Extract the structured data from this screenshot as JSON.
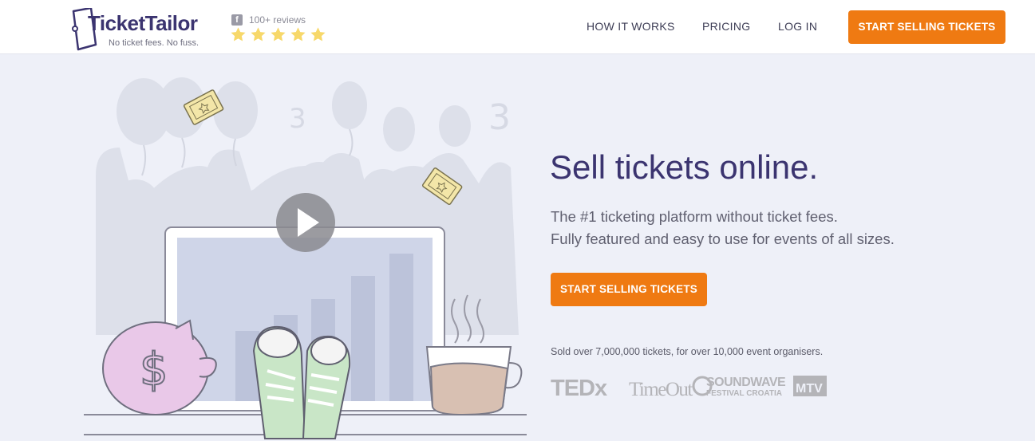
{
  "header": {
    "logo": {
      "name": "TicketTailor",
      "tagline": "No ticket fees. No fuss."
    },
    "reviews": {
      "count_label": "100+ reviews",
      "rating": 5,
      "source_icon": "facebook-icon"
    },
    "nav": [
      {
        "label": "HOW IT WORKS"
      },
      {
        "label": "PRICING"
      },
      {
        "label": "LOG IN"
      }
    ],
    "cta_label": "START SELLING TICKETS"
  },
  "hero": {
    "title": "Sell tickets online.",
    "subtitle_line1": "The #1 ticketing platform without ticket fees.",
    "subtitle_line2": "Fully featured and easy to use for events of all sizes.",
    "cta_label": "START SELLING TICKETS",
    "sold_text": "Sold over 7,000,000 tickets, for over 10,000 event organisers.",
    "client_logos": [
      {
        "name": "TEDx",
        "text": "TEDx"
      },
      {
        "name": "TimeOut",
        "text": "TimeOut"
      },
      {
        "name": "Soundwave Festival Croatia",
        "text1": "SOUNDWAVE",
        "text2": "FESTIVAL CROATIA"
      },
      {
        "name": "MTV",
        "text": "MTV"
      }
    ]
  },
  "colors": {
    "brand": "#3b3470",
    "accent": "#ef7a12",
    "background": "#eef0f8",
    "star": "#f7d86a"
  },
  "icons": [
    "facebook-icon",
    "star-icon",
    "play-icon",
    "ticket-icon"
  ]
}
